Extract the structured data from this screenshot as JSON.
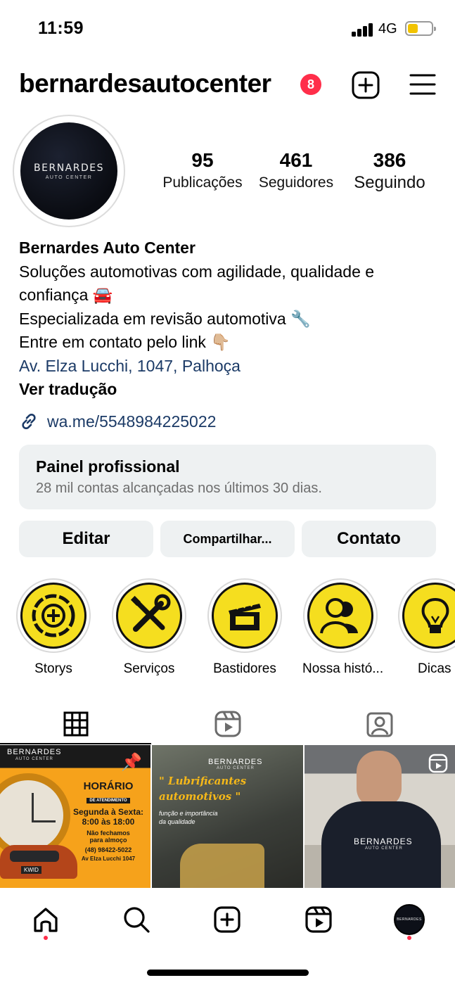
{
  "status_bar": {
    "time": "11:59",
    "network": "4G",
    "battery_level": 0.45
  },
  "header": {
    "username": "bernardesautocenter",
    "notification_count": "8"
  },
  "avatar": {
    "brand_main": "BERNARDES",
    "brand_sub": "AUTO CENTER"
  },
  "stats": [
    {
      "value": "95",
      "label": "Publicações"
    },
    {
      "value": "461",
      "label": "Seguidores"
    },
    {
      "value": "386",
      "label": "Seguindo"
    }
  ],
  "bio": {
    "name": "Bernardes Auto Center",
    "line1": "Soluções automotivas com agilidade, qualidade e",
    "line2": "confiança 🚘",
    "line3": "Especializada em revisão automotiva 🔧",
    "line4": "Entre em contato pelo link 👇🏼",
    "address": "Av. Elza Lucchi, 1047, Palhoça",
    "translate": "Ver tradução",
    "link": "wa.me/5548984225022"
  },
  "dashboard": {
    "title": "Painel profissional",
    "subtitle": "28 mil contas alcançadas nos últimos 30 dias."
  },
  "actions": {
    "edit": "Editar",
    "share": "Compartilhar...",
    "contact": "Contato"
  },
  "highlights": [
    {
      "label": "Storys",
      "icon": "plus-circle-icon"
    },
    {
      "label": "Serviços",
      "icon": "tools-icon"
    },
    {
      "label": "Bastidores",
      "icon": "clapperboard-icon"
    },
    {
      "label": "Nossa histó...",
      "icon": "people-icon"
    },
    {
      "label": "Dicas",
      "icon": "lightbulb-icon"
    }
  ],
  "posts": [
    {
      "brand": "BERNARDES",
      "brand_sub": "AUTO CENTER",
      "heading": "HORÁRIO",
      "heading_sub": "DE ATENDIMENTO",
      "schedule_title": "Segunda à Sexta:",
      "schedule_hours": "8:00 às 18:00",
      "lunch1": "Não fechamos",
      "lunch2": "para almoço",
      "phone": "(48) 98422-5022",
      "address": "Av Elza Lucchi 1047",
      "car_plate": "KWID"
    },
    {
      "brand": "BERNARDES",
      "brand_sub": "AUTO CENTER",
      "title1": "\" Lubrificantes",
      "title2": "automotivos \"",
      "sub1": "função e importância",
      "sub2": "da qualidade"
    },
    {
      "brand": "BERNARDES",
      "brand_sub": "AUTO CENTER"
    }
  ],
  "colors": {
    "accent_red": "#ff2e4a",
    "link_blue": "#1b3a66",
    "highlight_yellow": "#f5de1f",
    "brand_orange": "#f5a31a"
  }
}
